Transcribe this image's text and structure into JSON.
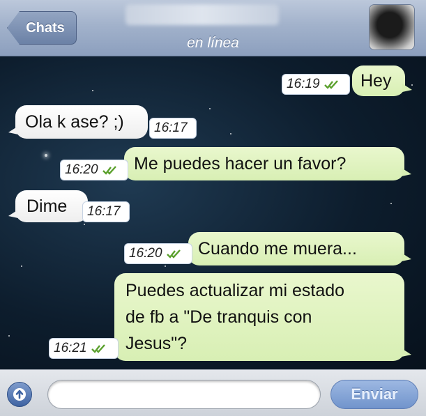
{
  "header": {
    "back_label": "Chats",
    "status": "en línea"
  },
  "messages": [
    {
      "direction": "out",
      "text": "Hey",
      "time": "16:19"
    },
    {
      "direction": "in",
      "text": "Ola k ase? ;)",
      "time": "16:17"
    },
    {
      "direction": "out",
      "text": "Me puedes hacer un favor?",
      "time": "16:20"
    },
    {
      "direction": "in",
      "text": "Dime",
      "time": "16:17"
    },
    {
      "direction": "out",
      "text": "Cuando me muera...",
      "time": "16:20"
    },
    {
      "direction": "out",
      "lines": [
        "Puedes actualizar mi estado",
        "de fb a \"De tranquis con",
        "Jesus\"?"
      ],
      "time": "16:21"
    }
  ],
  "composer": {
    "placeholder": "",
    "send_label": "Enviar"
  },
  "colors": {
    "header": "#a2b2cb",
    "outgoing_bubble": "#d8efb4",
    "incoming_bubble": "#ffffff",
    "read_ticks": "#5aa02c",
    "send_button": "#7194cc"
  }
}
